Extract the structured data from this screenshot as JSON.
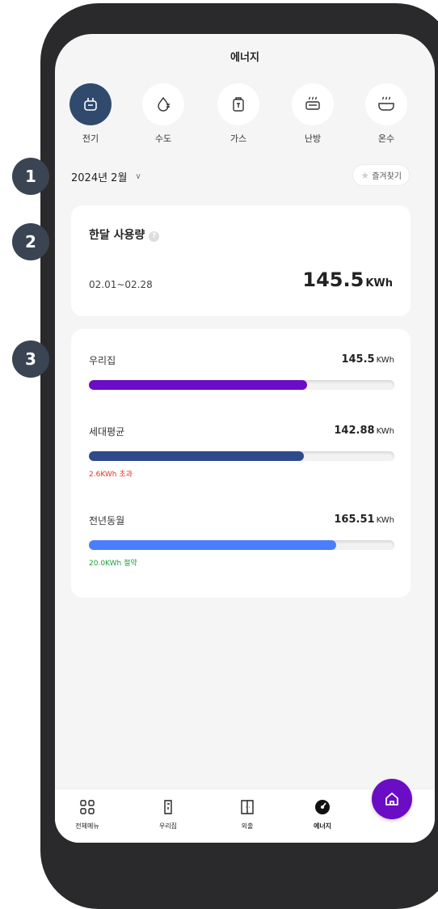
{
  "header": {
    "title": "에너지"
  },
  "categories": [
    {
      "label": "전기",
      "icon": "plug-icon",
      "active": true
    },
    {
      "label": "수도",
      "icon": "water-drop-icon",
      "active": false
    },
    {
      "label": "가스",
      "icon": "gas-can-icon",
      "active": false
    },
    {
      "label": "난방",
      "icon": "heater-icon",
      "active": false
    },
    {
      "label": "온수",
      "icon": "bathtub-icon",
      "active": false
    }
  ],
  "period": {
    "month": "2024년 2월",
    "favorite_label": "즐겨찾기"
  },
  "monthly": {
    "title": "한달 사용량",
    "help": "?",
    "range": "02.01~02.28",
    "value": "145.5",
    "unit": "KWh"
  },
  "comparison": [
    {
      "label": "우리집",
      "value": "145.5",
      "unit": "KWh",
      "fraction": 0.715,
      "color": "#6a0dc4",
      "note": ""
    },
    {
      "label": "세대평균",
      "value": "142.88",
      "unit": "KWh",
      "fraction": 0.705,
      "color": "#2f4a8a",
      "note": "2.6KWh 초과",
      "note_color": "#e0322b"
    },
    {
      "label": "전년동월",
      "value": "165.51",
      "unit": "KWh",
      "fraction": 0.81,
      "color": "#4a7dff",
      "note": "20.0KWh 절약",
      "note_color": "#1e9e3a"
    }
  ],
  "nav": [
    {
      "label": "전체메뉴",
      "icon": "grid-icon"
    },
    {
      "label": "우리집",
      "icon": "door-lock-icon"
    },
    {
      "label": "외출",
      "icon": "door-icon"
    },
    {
      "label": "에너지",
      "icon": "gauge-icon"
    }
  ],
  "fab": {
    "icon": "home-icon"
  },
  "markers": [
    "1",
    "2",
    "3"
  ]
}
